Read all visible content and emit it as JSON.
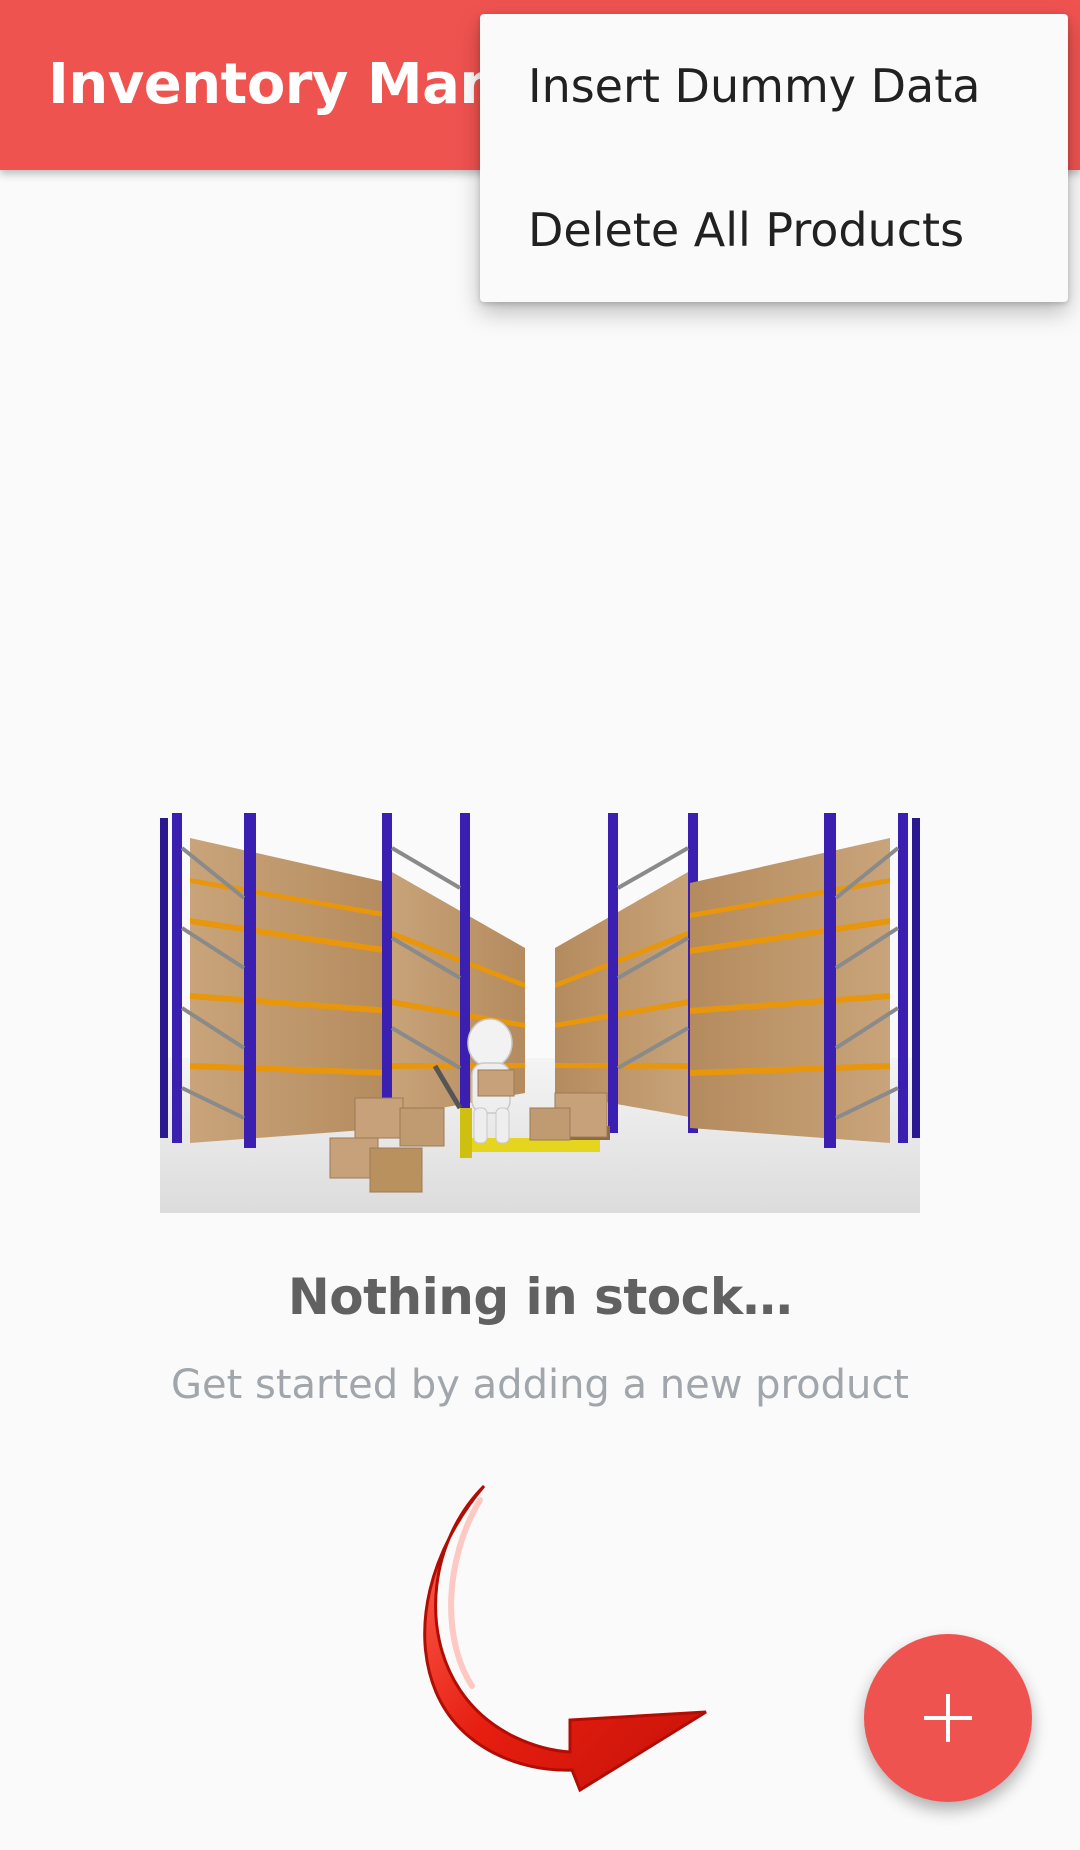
{
  "app_bar": {
    "title": "Inventory Management",
    "color": "#ef5350"
  },
  "overflow_menu": {
    "items": [
      {
        "label": "Insert Dummy Data"
      },
      {
        "label": "Delete All Products"
      }
    ]
  },
  "empty_state": {
    "illustration": "warehouse-shelves-illustration",
    "title": "Nothing in stock…",
    "subtitle": "Get started by adding a new product",
    "arrow_icon": "curved-arrow-icon",
    "arrow_color": "#e53935"
  },
  "fab": {
    "icon": "plus-icon",
    "color": "#ef5350"
  }
}
